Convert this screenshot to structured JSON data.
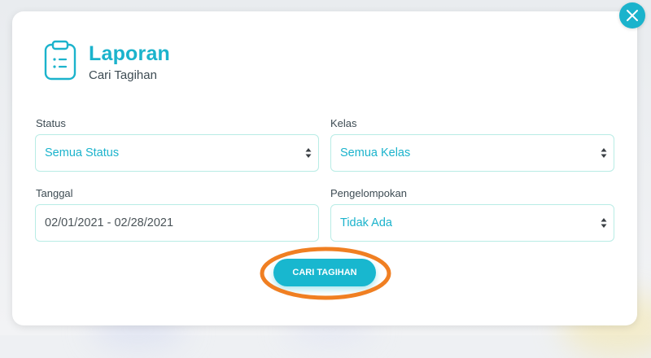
{
  "header": {
    "title": "Laporan",
    "subtitle": "Cari Tagihan",
    "icon": "clipboard-icon"
  },
  "form": {
    "status": {
      "label": "Status",
      "value": "Semua Status"
    },
    "kelas": {
      "label": "Kelas",
      "value": "Semua Kelas"
    },
    "tanggal": {
      "label": "Tanggal",
      "value": "02/01/2021 - 02/28/2021"
    },
    "pengelompokan": {
      "label": "Pengelompokan",
      "value": "Tidak Ada"
    }
  },
  "actions": {
    "search_label": "CARI TAGIHAN",
    "close_icon": "close-icon"
  },
  "colors": {
    "accent": "#1bb3cc",
    "border": "#b8ece5",
    "highlight": "#f07f22"
  }
}
